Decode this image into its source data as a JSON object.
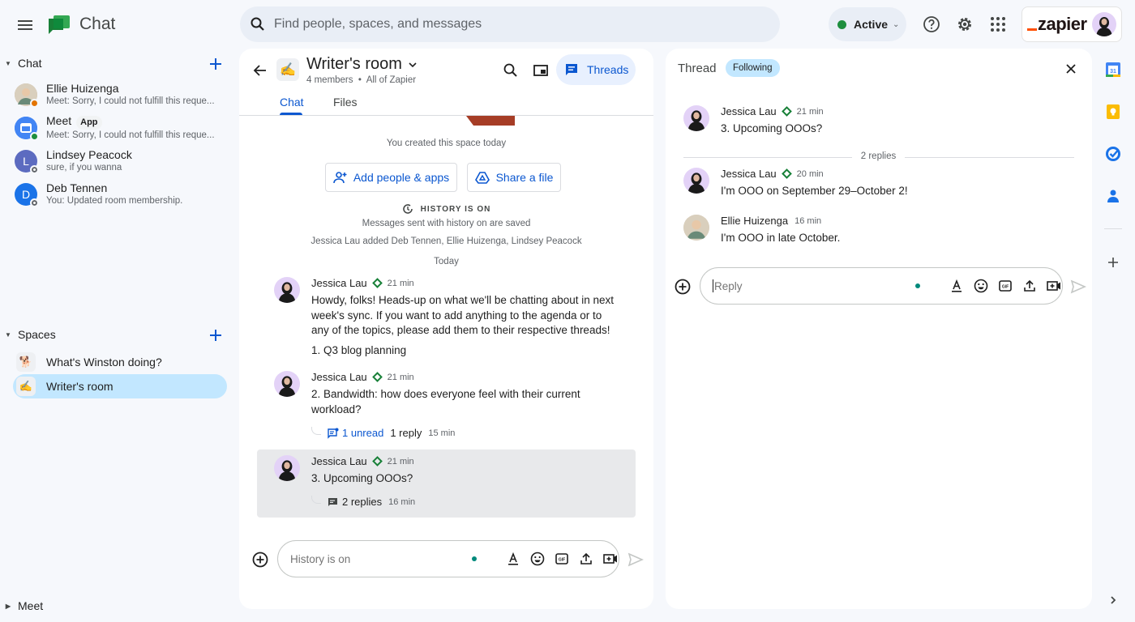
{
  "app": {
    "title": "Chat",
    "search_placeholder": "Find people, spaces, and messages",
    "status": "Active",
    "account_brand": "zapier"
  },
  "colors": {
    "accent": "#0b57d0",
    "selected_bg": "#c2e7ff",
    "active_status": "#1e8e3e",
    "zapier_orange": "#ff4f00",
    "verified": "#188038"
  },
  "sidebar": {
    "chat_section": "Chat",
    "dms": [
      {
        "name": "Ellie Huizenga",
        "preview": "Meet: Sorry, I could not fulfill this reque...",
        "status": "away"
      },
      {
        "name": "Meet",
        "chip": "App",
        "preview": "Meet: Sorry, I could not fulfill this reque...",
        "status": "online"
      },
      {
        "name": "Lindsey Peacock",
        "initial": "L",
        "preview": "sure, if you wanna",
        "status": "offline"
      },
      {
        "name": "Deb Tennen",
        "initial": "D",
        "preview": "You: Updated room membership.",
        "status": "offline"
      }
    ],
    "spaces_section": "Spaces",
    "spaces": [
      {
        "name": "What's Winston doing?",
        "emoji": "🐕",
        "selected": false
      },
      {
        "name": "Writer's room",
        "emoji": "✍",
        "selected": true
      }
    ],
    "meet_section": "Meet"
  },
  "room": {
    "title": "Writer's room",
    "members": "4 members",
    "audience": "All of Zapier",
    "threads_label": "Threads",
    "tabs": [
      {
        "label": "Chat",
        "active": true
      },
      {
        "label": "Files",
        "active": false
      }
    ],
    "created_note": "You created this space today",
    "add_people_label": "Add people & apps",
    "share_file_label": "Share a file",
    "history_heading": "HISTORY IS ON",
    "history_note": "Messages sent with history on are saved",
    "added_note": "Jessica Lau added Deb Tennen, Ellie Huizenga, Lindsey Peacock",
    "date_divider": "Today",
    "messages": [
      {
        "author": "Jessica Lau",
        "time": "21 min",
        "body": "Howdy, folks! Heads-up on what we'll be chatting about in next week's sync. If you want to add anything to the agenda or to any of the topics, please add them to their respective threads!",
        "body2": "1. Q3 blog planning"
      },
      {
        "author": "Jessica Lau",
        "time": "21 min",
        "body": "2. Bandwidth: how does everyone feel with their current workload?",
        "unread": "1 unread",
        "replies": "1 reply",
        "reply_time": "15 min"
      },
      {
        "author": "Jessica Lau",
        "time": "21 min",
        "body": "3. Upcoming OOOs?",
        "replies": "2 replies",
        "reply_time": "16 min"
      }
    ],
    "composer_placeholder": "History is on"
  },
  "thread": {
    "title": "Thread",
    "badge": "Following",
    "root": {
      "author": "Jessica Lau",
      "time": "21 min",
      "body": "3. Upcoming OOOs?"
    },
    "reply_count": "2 replies",
    "replies": [
      {
        "author": "Jessica Lau",
        "time": "20 min",
        "body": "I'm OOO on September 29–October 2!",
        "verified": true
      },
      {
        "author": "Ellie Huizenga",
        "time": "16 min",
        "body": "I'm OOO in late October.",
        "verified": false
      }
    ],
    "reply_placeholder": "Reply"
  },
  "rail": {
    "items": [
      "calendar",
      "keep",
      "tasks",
      "contacts",
      "add"
    ],
    "calendar_day": "31"
  }
}
